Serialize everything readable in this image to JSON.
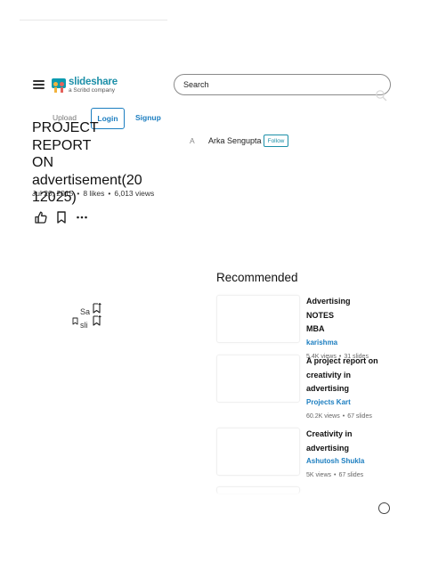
{
  "header": {
    "logo_name": "slideshare",
    "logo_sub": "a Scribd company",
    "search_placeholder": "Search",
    "nav": {
      "upload": "Upload",
      "login": "Login",
      "signup": "Signup"
    }
  },
  "document": {
    "title_lines": [
      "PROJECT REPORT",
      "ON",
      "advertisement(20",
      "12025)"
    ],
    "date": "Jul 20, 2015",
    "likes": "8 likes",
    "views": "6,013 views",
    "author_initial": "A",
    "author_name": "Arka Sengupta",
    "follow_label": "Follow"
  },
  "viewer": {
    "line1": "Sa",
    "line2": "sli"
  },
  "recommended": {
    "title": "Recommended",
    "items": [
      {
        "name_lines": [
          "Advertising NOTES",
          "MBA"
        ],
        "author": "karishma",
        "views": "5.4K views",
        "slides": "31 slides"
      },
      {
        "name_lines": [
          "A project report on",
          "creativity in",
          "advertising"
        ],
        "author": "Projects Kart",
        "views": "60.2K views",
        "slides": "67 slides"
      },
      {
        "name_lines": [
          "Creativity in",
          "advertising"
        ],
        "author": "Ashutosh Shukla",
        "views": "5K views",
        "slides": "67 slides"
      }
    ]
  },
  "colors": {
    "brand": "#1c8fa8",
    "link": "#1c7ec0"
  },
  "icons": [
    "menu-icon",
    "search-icon",
    "like-icon",
    "bookmark-icon",
    "more-icon",
    "bookmark-plus-icon"
  ]
}
